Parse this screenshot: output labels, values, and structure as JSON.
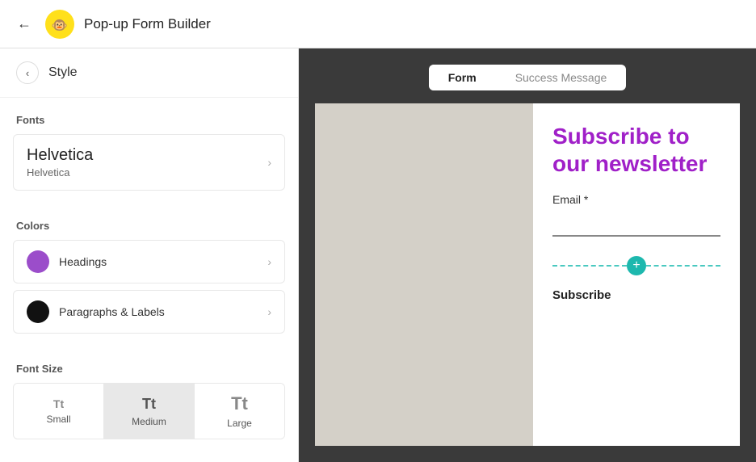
{
  "topbar": {
    "back_icon": "←",
    "title": "Pop-up Form Builder",
    "logo_alt": "Mailchimp logo"
  },
  "panel": {
    "back_icon": "‹",
    "title": "Style",
    "fonts_label": "Fonts",
    "font_name": "Helvetica",
    "font_sub": "Helvetica",
    "colors_label": "Colors",
    "headings_label": "Headings",
    "headings_color": "#9b4dca",
    "paragraphs_label": "Paragraphs & Labels",
    "paragraphs_color": "#000000",
    "font_size_label": "Font Size",
    "size_small": "Small",
    "size_medium": "Medium",
    "size_large": "Large"
  },
  "preview": {
    "tab_form": "Form",
    "tab_success": "Success Message",
    "subscribe_title": "Subscribe to our newsletter",
    "email_label": "Email *",
    "email_placeholder": "",
    "subscribe_button": "Subscribe",
    "plus_icon": "+"
  }
}
